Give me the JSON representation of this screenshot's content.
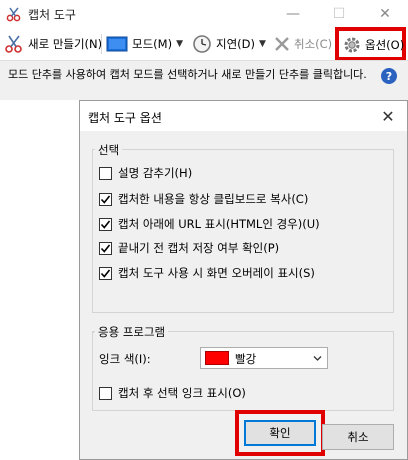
{
  "main_window": {
    "title": "캡처 도구",
    "minimize": "—",
    "maximize": "☐",
    "close": "✕",
    "toolbar": {
      "new_label": "새로 만들기(N)",
      "mode_label": "모드(M)",
      "delay_label": "지연(D)",
      "cancel_label": "취소(C)",
      "options_label": "옵션(O)",
      "dropdown_arrow": "▼"
    },
    "description": "모드 단추를 사용하여 캡처 모드를 선택하거나 새로 만들기 단추를 클릭합니다.",
    "help": "?"
  },
  "options_dialog": {
    "title": "캡처 도구 옵션",
    "close": "✕",
    "selection_group": {
      "label": "선택",
      "options": [
        {
          "label": "설명 감추기(H)",
          "checked": false
        },
        {
          "label": "캡처한 내용을 항상 클립보드로 복사(C)",
          "checked": true
        },
        {
          "label": "캡처 아래에 URL 표시(HTML인 경우)(U)",
          "checked": true
        },
        {
          "label": "끝내기 전 캡처 저장 여부 확인(P)",
          "checked": true
        },
        {
          "label": "캡처 도구 사용 시 화면 오버레이 표시(S)",
          "checked": true
        }
      ]
    },
    "app_group": {
      "label": "응용 프로그램",
      "ink_color_label": "잉크 색(I):",
      "ink_color_value": "빨강",
      "ink_color_swatch": "#ff0000",
      "show_ink_label": "캡처 후 선택 잉크 표시(O)",
      "show_ink_checked": false
    },
    "ok_label": "확인",
    "cancel_label": "취소"
  },
  "colors": {
    "highlight": "#e00000",
    "accent": "#0078d7"
  }
}
